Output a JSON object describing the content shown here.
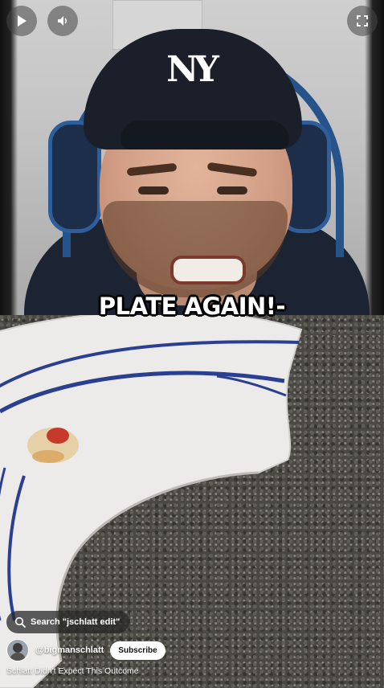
{
  "video": {
    "caption": "PLATE AGAIN!-",
    "title": "Schlatt Didn't Expect This Outcome"
  },
  "controls": {
    "play_icon": "play-icon",
    "volume_icon": "volume-icon",
    "fullscreen_icon": "fullscreen-icon"
  },
  "search": {
    "label": "Search \"jschlatt edit\"",
    "icon": "search-icon"
  },
  "channel": {
    "handle": "@bigmanschlatt",
    "subscribe_label": "Subscribe"
  },
  "colors": {
    "plate_rim": "#2a3f8f",
    "overlay": "#464646",
    "caption_text": "#ffffff"
  }
}
